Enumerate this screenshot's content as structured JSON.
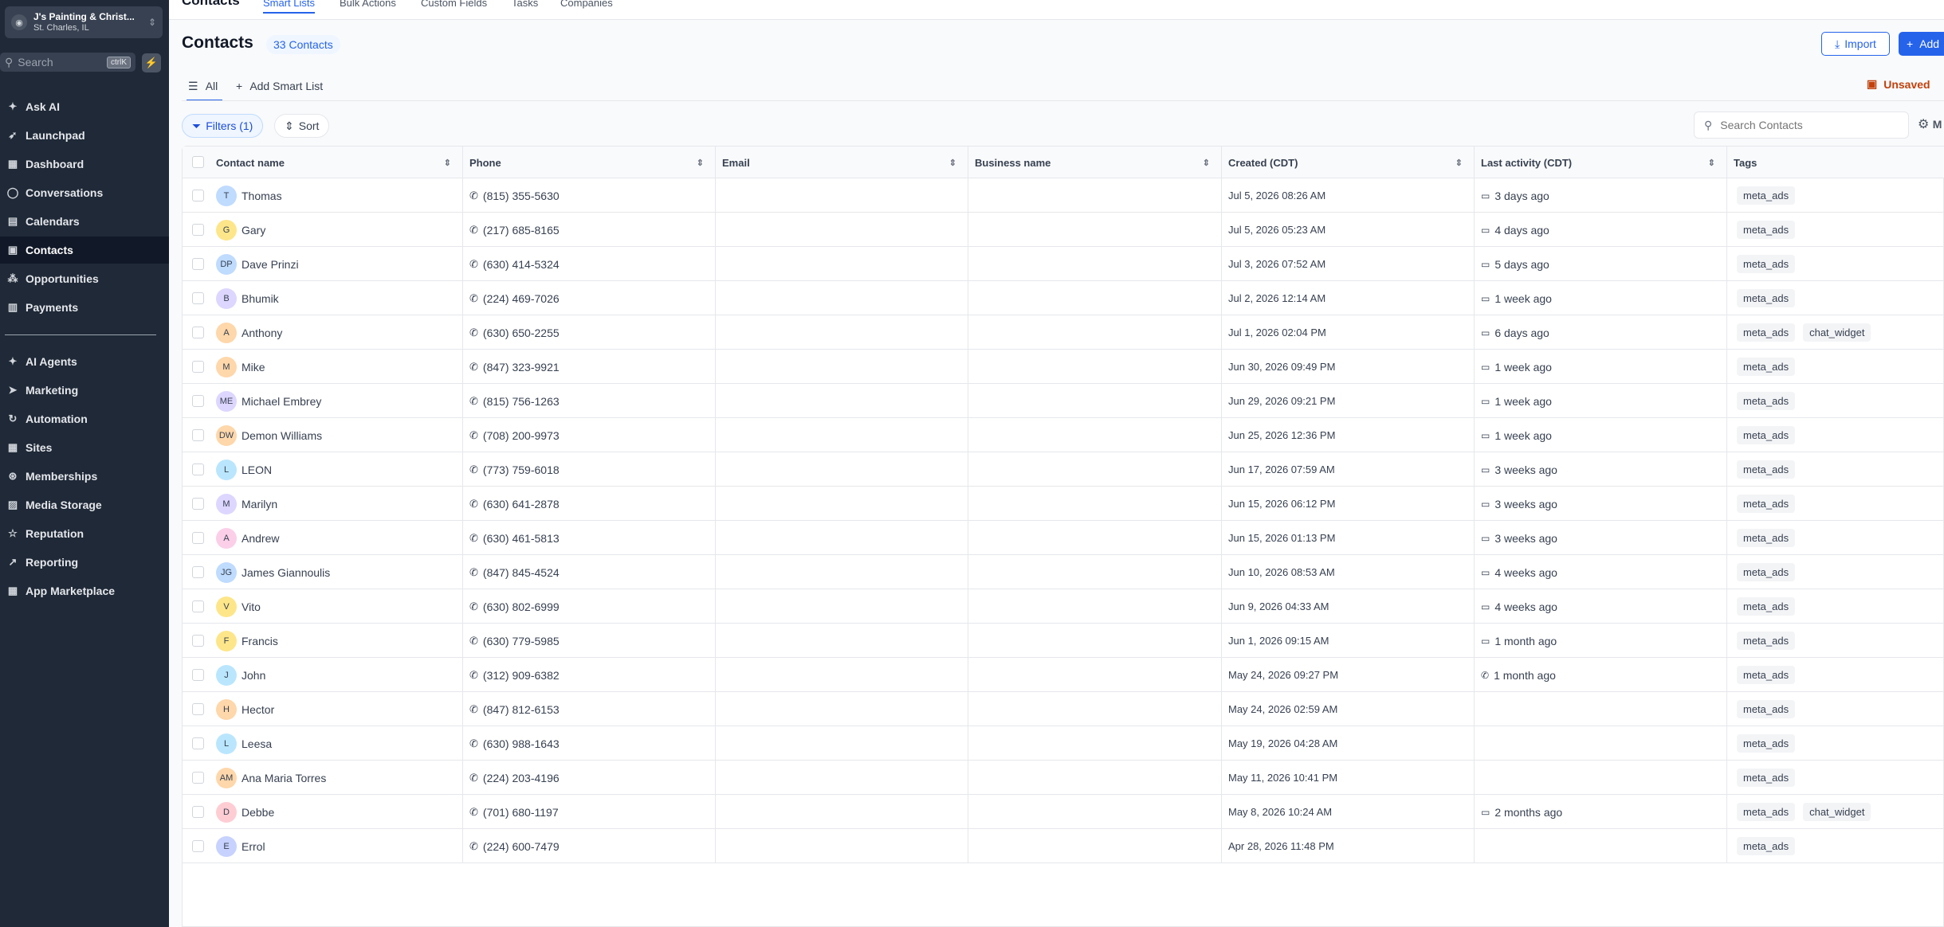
{
  "sidebar": {
    "account": {
      "name": "J's Painting & Christ...",
      "location": "St. Charles, IL"
    },
    "search": {
      "placeholder": "Search",
      "shortcut": "ctrlK"
    },
    "nav": [
      {
        "label": "Ask AI",
        "icon": "sparkle-icon"
      },
      {
        "label": "Launchpad",
        "icon": "rocket-icon"
      },
      {
        "label": "Dashboard",
        "icon": "grid-icon"
      },
      {
        "label": "Conversations",
        "icon": "chat-icon"
      },
      {
        "label": "Calendars",
        "icon": "calendar-icon"
      },
      {
        "label": "Contacts",
        "icon": "contacts-icon",
        "active": true
      },
      {
        "label": "Opportunities",
        "icon": "network-icon"
      },
      {
        "label": "Payments",
        "icon": "receipt-icon"
      }
    ],
    "nav2": [
      {
        "label": "AI Agents",
        "icon": "sparkle-icon"
      },
      {
        "label": "Marketing",
        "icon": "send-icon"
      },
      {
        "label": "Automation",
        "icon": "automation-icon"
      },
      {
        "label": "Sites",
        "icon": "sites-icon"
      },
      {
        "label": "Memberships",
        "icon": "membership-icon"
      },
      {
        "label": "Media Storage",
        "icon": "image-icon"
      },
      {
        "label": "Reputation",
        "icon": "star-icon"
      },
      {
        "label": "Reporting",
        "icon": "trend-icon"
      },
      {
        "label": "App Marketplace",
        "icon": "apps-icon"
      }
    ]
  },
  "topnav": [
    "Contacts",
    "Smart Lists",
    "Bulk Actions",
    "Custom Fields",
    "Tasks",
    "Companies"
  ],
  "header": {
    "title": "Contacts",
    "count": "33 Contacts",
    "import": "Import",
    "add": "Add"
  },
  "tabs": {
    "all": "All",
    "add_smart_list": "Add Smart List",
    "unsaved": "Unsaved"
  },
  "toolbar": {
    "filters": "Filters (1)",
    "sort": "Sort",
    "search_placeholder": "Search Contacts",
    "more": "M"
  },
  "columns": [
    "Contact name",
    "Phone",
    "Email",
    "Business name",
    "Created (CDT)",
    "Last activity (CDT)",
    "Tags"
  ],
  "rows": [
    {
      "initials": "T",
      "name": "Thomas",
      "phone": "(815) 355-5630",
      "created": "Jul 5, 2026 08:26 AM",
      "activity": "3 days ago",
      "activity_icon": "chat",
      "tags": [
        "meta_ads"
      ],
      "color": "#bfdbfe"
    },
    {
      "initials": "G",
      "name": "Gary",
      "phone": "(217) 685-8165",
      "created": "Jul 5, 2026 05:23 AM",
      "activity": "4 days ago",
      "activity_icon": "chat",
      "tags": [
        "meta_ads"
      ],
      "color": "#fde68a"
    },
    {
      "initials": "DP",
      "name": "Dave Prinzi",
      "phone": "(630) 414-5324",
      "created": "Jul 3, 2026 07:52 AM",
      "activity": "5 days ago",
      "activity_icon": "chat",
      "tags": [
        "meta_ads"
      ],
      "color": "#bfdbfe"
    },
    {
      "initials": "B",
      "name": "Bhumik",
      "phone": "(224) 469-7026",
      "created": "Jul 2, 2026 12:14 AM",
      "activity": "1 week ago",
      "activity_icon": "chat",
      "tags": [
        "meta_ads"
      ],
      "color": "#ddd6fe"
    },
    {
      "initials": "A",
      "name": "Anthony",
      "phone": "(630) 650-2255",
      "created": "Jul 1, 2026 02:04 PM",
      "activity": "6 days ago",
      "activity_icon": "chat",
      "tags": [
        "meta_ads",
        "chat_widget"
      ],
      "color": "#fed7aa"
    },
    {
      "initials": "M",
      "name": "Mike",
      "phone": "(847) 323-9921",
      "created": "Jun 30, 2026 09:49 PM",
      "activity": "1 week ago",
      "activity_icon": "chat",
      "tags": [
        "meta_ads"
      ],
      "color": "#fed7aa"
    },
    {
      "initials": "ME",
      "name": "Michael Embrey",
      "phone": "(815) 756-1263",
      "created": "Jun 29, 2026 09:21 PM",
      "activity": "1 week ago",
      "activity_icon": "chat",
      "tags": [
        "meta_ads"
      ],
      "color": "#ddd6fe"
    },
    {
      "initials": "DW",
      "name": "Demon Williams",
      "phone": "(708) 200-9973",
      "created": "Jun 25, 2026 12:36 PM",
      "activity": "1 week ago",
      "activity_icon": "chat",
      "tags": [
        "meta_ads"
      ],
      "color": "#fed7aa"
    },
    {
      "initials": "L",
      "name": "LEON",
      "phone": "(773) 759-6018",
      "created": "Jun 17, 2026 07:59 AM",
      "activity": "3 weeks ago",
      "activity_icon": "chat",
      "tags": [
        "meta_ads"
      ],
      "color": "#bae6fd"
    },
    {
      "initials": "M",
      "name": "Marilyn",
      "phone": "(630) 641-2878",
      "created": "Jun 15, 2026 06:12 PM",
      "activity": "3 weeks ago",
      "activity_icon": "chat",
      "tags": [
        "meta_ads"
      ],
      "color": "#ddd6fe"
    },
    {
      "initials": "A",
      "name": "Andrew",
      "phone": "(630) 461-5813",
      "created": "Jun 15, 2026 01:13 PM",
      "activity": "3 weeks ago",
      "activity_icon": "chat",
      "tags": [
        "meta_ads"
      ],
      "color": "#fbcfe8"
    },
    {
      "initials": "JG",
      "name": "James Giannoulis",
      "phone": "(847) 845-4524",
      "created": "Jun 10, 2026 08:53 AM",
      "activity": "4 weeks ago",
      "activity_icon": "chat",
      "tags": [
        "meta_ads"
      ],
      "color": "#bfdbfe"
    },
    {
      "initials": "V",
      "name": "Vito",
      "phone": "(630) 802-6999",
      "created": "Jun 9, 2026 04:33 AM",
      "activity": "4 weeks ago",
      "activity_icon": "chat",
      "tags": [
        "meta_ads"
      ],
      "color": "#fde68a"
    },
    {
      "initials": "F",
      "name": "Francis",
      "phone": "(630) 779-5985",
      "created": "Jun 1, 2026 09:15 AM",
      "activity": "1 month ago",
      "activity_icon": "chat",
      "tags": [
        "meta_ads"
      ],
      "color": "#fde68a"
    },
    {
      "initials": "J",
      "name": "John",
      "phone": "(312) 909-6382",
      "created": "May 24, 2026 09:27 PM",
      "activity": "1 month ago",
      "activity_icon": "phone",
      "tags": [
        "meta_ads"
      ],
      "color": "#bae6fd"
    },
    {
      "initials": "H",
      "name": "Hector",
      "phone": "(847) 812-6153",
      "created": "May 24, 2026 02:59 AM",
      "activity": "",
      "activity_icon": "",
      "tags": [
        "meta_ads"
      ],
      "color": "#fed7aa"
    },
    {
      "initials": "L",
      "name": "Leesa",
      "phone": "(630) 988-1643",
      "created": "May 19, 2026 04:28 AM",
      "activity": "",
      "activity_icon": "",
      "tags": [
        "meta_ads"
      ],
      "color": "#bae6fd"
    },
    {
      "initials": "AM",
      "name": "Ana Maria Torres",
      "phone": "(224) 203-4196",
      "created": "May 11, 2026 10:41 PM",
      "activity": "",
      "activity_icon": "",
      "tags": [
        "meta_ads"
      ],
      "color": "#fed7aa"
    },
    {
      "initials": "D",
      "name": "Debbe",
      "phone": "(701) 680-1197",
      "created": "May 8, 2026 10:24 AM",
      "activity": "2 months ago",
      "activity_icon": "chat",
      "tags": [
        "meta_ads",
        "chat_widget"
      ],
      "color": "#fecdd3"
    },
    {
      "initials": "E",
      "name": "Errol",
      "phone": "(224) 600-7479",
      "created": "Apr 28, 2026 11:48 PM",
      "activity": "",
      "activity_icon": "",
      "tags": [
        "meta_ads"
      ],
      "color": "#c7d2fe"
    }
  ]
}
